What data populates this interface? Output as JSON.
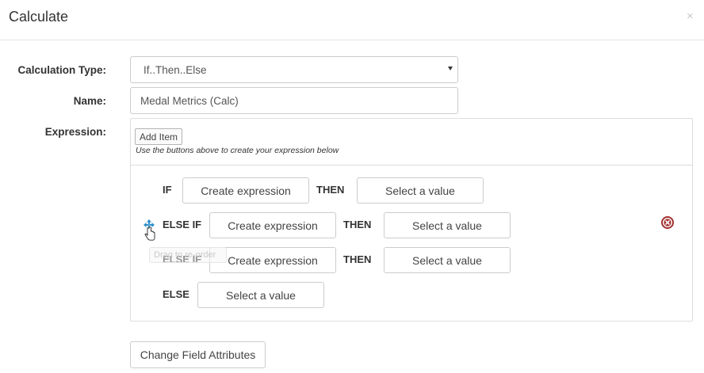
{
  "dialog": {
    "title": "Calculate",
    "close_glyph": "×"
  },
  "form": {
    "calc_type_label": "Calculation Type:",
    "calc_type_value": "If..Then..Else",
    "name_label": "Name:",
    "name_value": "Medal Metrics (Calc)",
    "expression_label": "Expression:"
  },
  "builder": {
    "add_item_label": "Add Item",
    "hint": "Use the buttons above to create your expression below",
    "rows": [
      {
        "keyword": "IF",
        "expression": "Create expression",
        "then": "THEN",
        "value": "Select a value"
      },
      {
        "keyword": "ELSE IF",
        "expression": "Create expression",
        "then": "THEN",
        "value": "Select a value"
      },
      {
        "keyword": "ELSE IF",
        "expression": "Create expression",
        "then": "THEN",
        "value": "Select a value"
      }
    ],
    "else_row": {
      "keyword": "ELSE",
      "value": "Select a value"
    },
    "drag_tooltip": "Drag to re-order"
  },
  "footer": {
    "change_field_attributes": "Change Field Attributes"
  },
  "icons": {
    "drag": "move-icon",
    "remove": "remove-circle-icon",
    "close": "close-icon"
  },
  "colors": {
    "drag_icon": "#2a8fc8",
    "remove_icon": "#a33030"
  }
}
